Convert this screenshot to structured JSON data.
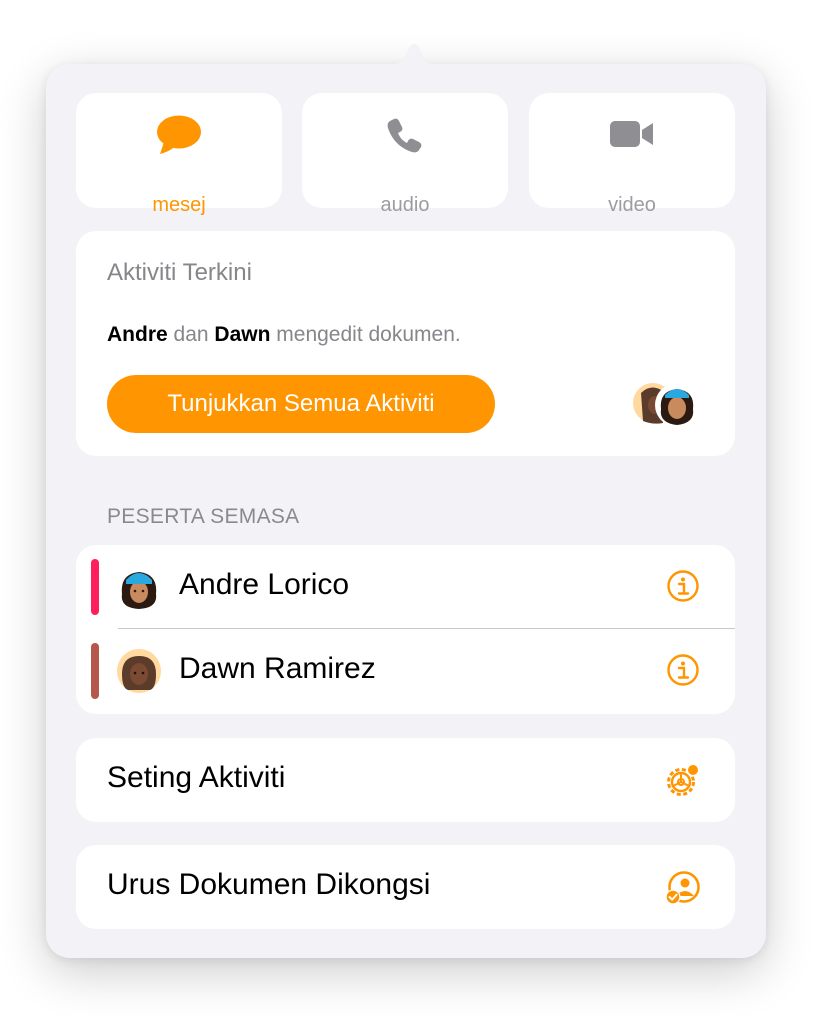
{
  "tabs": [
    {
      "label": "mesej",
      "icon": "message-bubble-icon",
      "active": true
    },
    {
      "label": "audio",
      "icon": "phone-icon",
      "active": false
    },
    {
      "label": "video",
      "icon": "video-camera-icon",
      "active": false
    }
  ],
  "recent_activity": {
    "title": "Aktiviti Terkini",
    "name1": "Andre",
    "conj": "dan",
    "name2": "Dawn",
    "action": "mengedit dokumen.",
    "button": "Tunjukkan Semua Aktiviti"
  },
  "participants": {
    "section_label": "PESERTA SEMASA",
    "items": [
      {
        "name": "Andre Lorico",
        "color": "#ff1f5a"
      },
      {
        "name": "Dawn Ramirez",
        "color": "#b5574b"
      }
    ]
  },
  "menu": {
    "activity_settings": "Seting Aktiviti",
    "manage_shared": "Urus Dokumen Dikongsi"
  },
  "colors": {
    "accent": "#ff9500",
    "inactive": "#9c9ca1"
  }
}
